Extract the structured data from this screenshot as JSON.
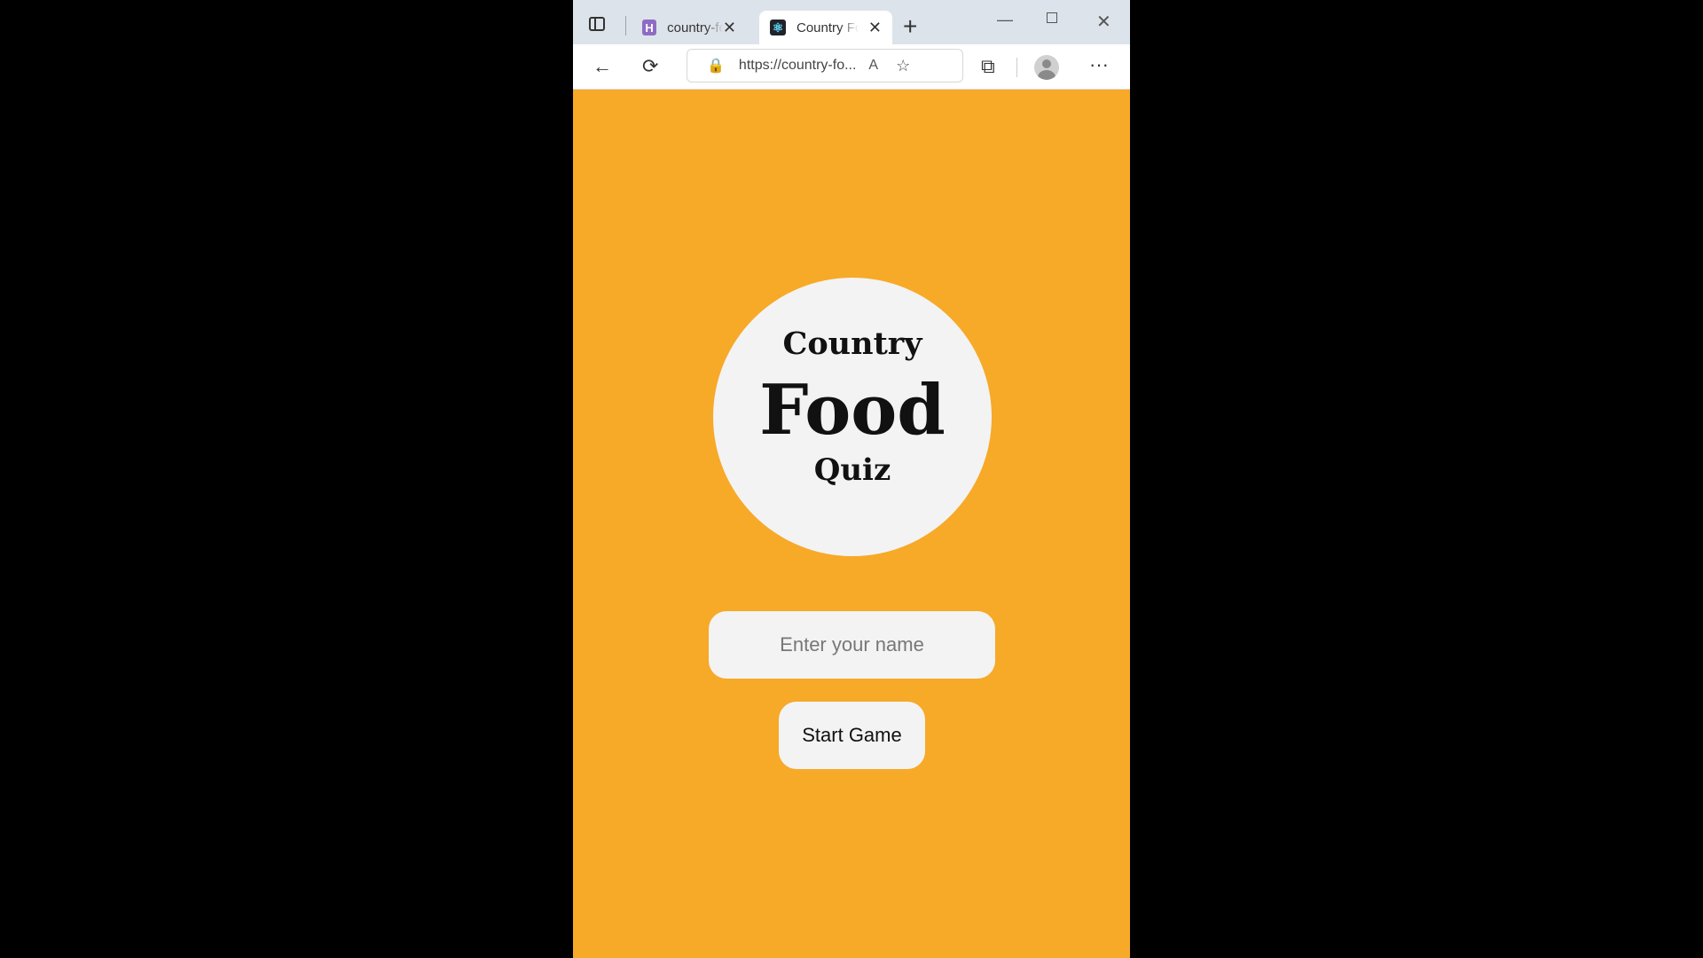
{
  "browser": {
    "tabs": [
      {
        "title": "country-food-quiz",
        "favicon": "h-letter-icon",
        "active": false
      },
      {
        "title": "Country Food Quiz",
        "favicon": "react-icon",
        "active": true
      }
    ],
    "url": "https://country-fo...",
    "icons": {
      "back": "←",
      "refresh": "⟳",
      "lock": "🔒",
      "read_aloud": "A",
      "favorite": "☆",
      "extensions": "⧉",
      "more": "···",
      "close": "✕",
      "new_tab": "+",
      "minimize": "—",
      "h": "H",
      "react": "⚛"
    }
  },
  "page": {
    "background": "#f7a928",
    "logo": {
      "line1": "Country",
      "line2": "Food",
      "line3": "Quiz"
    },
    "name_input": {
      "placeholder": "Enter your name",
      "value": ""
    },
    "start_button": "Start Game"
  }
}
